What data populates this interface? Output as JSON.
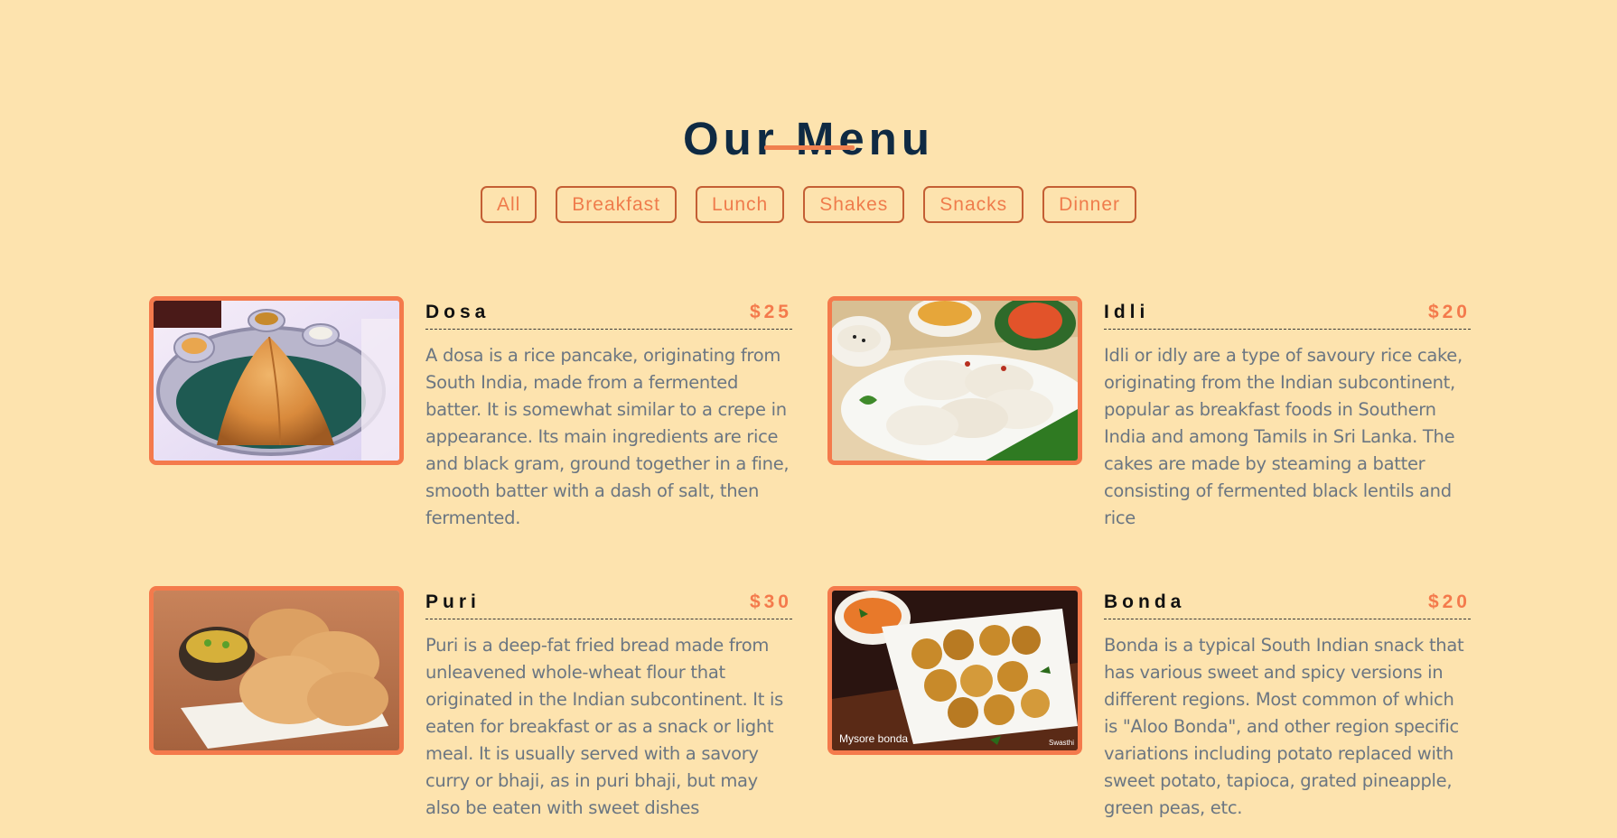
{
  "title": "Our Menu",
  "colors": {
    "background": "#fde3ae",
    "accent": "#f47a4c",
    "heading": "#0f2a43",
    "body_text": "#6b7682"
  },
  "filters": [
    "All",
    "Breakfast",
    "Lunch",
    "Shakes",
    "Snacks",
    "Dinner"
  ],
  "items": [
    {
      "name": "Dosa",
      "price": "$25",
      "image": "dosa-photo",
      "description": "A dosa is a rice pancake, originating from South India, made from a fermented batter. It is somewhat similar to a crepe in appearance. Its main ingredients are rice and black gram, ground together in a fine, smooth batter with a dash of salt, then fermented."
    },
    {
      "name": "Idli",
      "price": "$20",
      "image": "idli-photo",
      "description": "Idli or idly are a type of savoury rice cake, originating from the Indian subcontinent, popular as breakfast foods in Southern India and among Tamils in Sri Lanka. The cakes are made by steaming a batter consisting of fermented black lentils and rice"
    },
    {
      "name": "Puri",
      "price": "$30",
      "image": "puri-photo",
      "description": "Puri is a deep-fat fried bread made from unleavened whole-wheat flour that originated in the Indian subcontinent. It is eaten for breakfast or as a snack or light meal. It is usually served with a savory curry or bhaji, as in puri bhaji, but may also be eaten with sweet dishes"
    },
    {
      "name": "Bonda",
      "price": "$20",
      "image": "bonda-photo",
      "image_caption": "Mysore bonda",
      "image_credit": "Swasthi",
      "description": "Bonda is a typical South Indian snack that has various sweet and spicy versions in different regions. Most common of which is \"Aloo Bonda\", and other region specific variations including potato replaced with sweet potato, tapioca, grated pineapple, green peas, etc."
    }
  ]
}
